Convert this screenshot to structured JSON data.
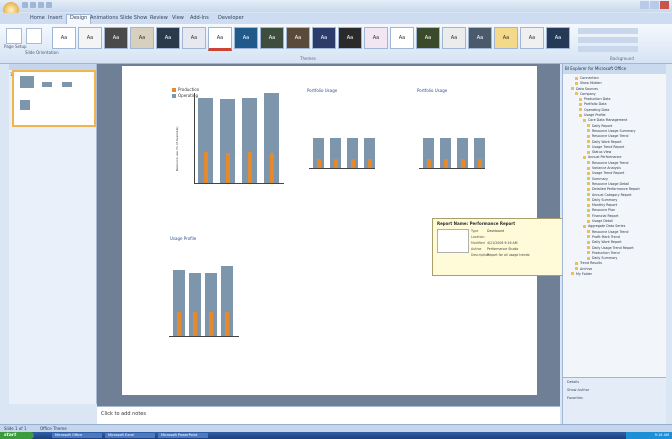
{
  "window": {
    "title": ""
  },
  "ribbon": {
    "tabs": [
      "Home",
      "Insert",
      "Design",
      "Animations",
      "Slide Show",
      "Review",
      "View",
      "Add-Ins",
      "Developer"
    ],
    "active_tab": "Design",
    "page_setup_label": "Page Setup",
    "orientation_label": "Slide Orientation",
    "themes_label": "Themes",
    "theme_sample": "Aa",
    "background_label": "Background"
  },
  "slide": {
    "charts": [
      {
        "name": "main",
        "title": "",
        "legend": [
          "Production",
          "Operating"
        ],
        "ylabel": "Resource use (% of Available)"
      },
      {
        "name": "top-mid",
        "title": "Portfolio Usage"
      },
      {
        "name": "top-right",
        "title": "Portfolio Usage"
      },
      {
        "name": "bottom-left",
        "title": "Usage Profile"
      }
    ]
  },
  "chart_data": [
    {
      "type": "bar",
      "title": "",
      "series": [
        {
          "name": "Production",
          "values": [
            35,
            33,
            34,
            33
          ]
        },
        {
          "name": "Operating",
          "values": [
            95,
            93,
            95,
            100
          ]
        }
      ],
      "categories": [
        "",
        "",
        "",
        ""
      ]
    },
    {
      "type": "bar",
      "title": "Portfolio Usage",
      "series": [
        {
          "values": [
            30,
            30,
            30,
            30
          ]
        },
        {
          "values": [
            100,
            100,
            100,
            100
          ]
        }
      ]
    },
    {
      "type": "bar",
      "title": "Portfolio Usage",
      "series": [
        {
          "values": [
            30,
            30,
            30,
            30
          ]
        },
        {
          "values": [
            100,
            100,
            100,
            100
          ]
        }
      ]
    },
    {
      "type": "bar",
      "title": "Usage Profile",
      "series": [
        {
          "values": [
            35,
            35,
            35,
            35
          ]
        },
        {
          "values": [
            95,
            90,
            90,
            100
          ]
        }
      ]
    }
  ],
  "notes": {
    "placeholder": "Click to add notes"
  },
  "task_pane": {
    "title": "BI Explorer for Microsoft Office",
    "tree": [
      "Connection",
      "Show Hidden",
      "Data Sources",
      "Company",
      "Production Data",
      "Portfolio Data",
      "Operating Data",
      "Usage Profile",
      "Core Data Management",
      "Daily Report",
      "Resource Usage Summary",
      "Resource Usage Trend",
      "Daily Work Report",
      "Usage Trend Report",
      "Status View",
      "Annual Performance",
      "Resource Usage Trend",
      "Variance Analysis",
      "Usage Trend Report",
      "Summary",
      "Resource Usage Detail",
      "Detailed Performance Report",
      "Annual Category Report",
      "Daily Summary",
      "Monthly Report",
      "Resource Plan",
      "Financial Report",
      "Usage Detail",
      "Aggregate Data Series",
      "Resource Usage Trend",
      "Profit Mark Trend",
      "Daily Work Report",
      "Daily Usage Trend Report",
      "Production Trend",
      "Daily Summary",
      "Trend Results",
      "Archive",
      "My Folder"
    ],
    "bottom": [
      "Details",
      "Show Author",
      "Favorites"
    ]
  },
  "tooltip": {
    "title": "Report Name: Performance Report",
    "rows": [
      {
        "k": "Type",
        "v": "Dashboard"
      },
      {
        "k": "Location",
        "v": ""
      },
      {
        "k": "Modified",
        "v": "4/21/2008 9:16 AM"
      },
      {
        "k": "Author",
        "v": "Performance Studio"
      },
      {
        "k": "Description",
        "v": "Report for all usage trends"
      }
    ]
  },
  "status": {
    "slide": "Slide 1 of 1",
    "theme": "Office Theme"
  },
  "taskbar": {
    "start": "start",
    "tasks": [
      "Microsoft Office",
      "Microsoft Excel",
      "Microsoft PowerPoint"
    ],
    "clock": "9:16 AM"
  },
  "colors": {
    "bar_blue": "#7d96ac",
    "bar_orange": "#e48a2c",
    "accent": "#f2b54d"
  }
}
